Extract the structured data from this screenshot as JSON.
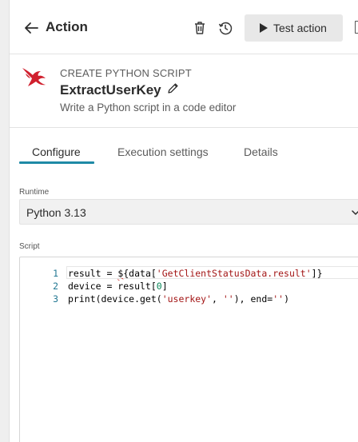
{
  "header": {
    "title": "Action",
    "test_button_label": "Test action"
  },
  "action": {
    "category": "CREATE PYTHON SCRIPT",
    "name": "ExtractUserKey",
    "description": "Write a Python script in a code editor"
  },
  "tabs": [
    {
      "label": "Configure",
      "active": true
    },
    {
      "label": "Execution settings",
      "active": false
    },
    {
      "label": "Details",
      "active": false
    }
  ],
  "runtime": {
    "label": "Runtime",
    "selected": "Python 3.13"
  },
  "script": {
    "label": "Script",
    "line_numbers": [
      "1",
      "2",
      "3"
    ],
    "lines": [
      "result = ${data['GetClientStatusData.result']}",
      "device = result[0]",
      "print(device.get('userkey', ''), end='')"
    ]
  },
  "colors": {
    "accent": "#1f8aa6",
    "logo_red": "#d0202e",
    "test_button_bg": "#e8e8e8"
  },
  "icons": [
    "back-arrow-icon",
    "trash-icon",
    "history-icon",
    "play-icon",
    "panel-icon",
    "falcon-logo-icon",
    "pencil-icon",
    "chevron-down-icon"
  ]
}
